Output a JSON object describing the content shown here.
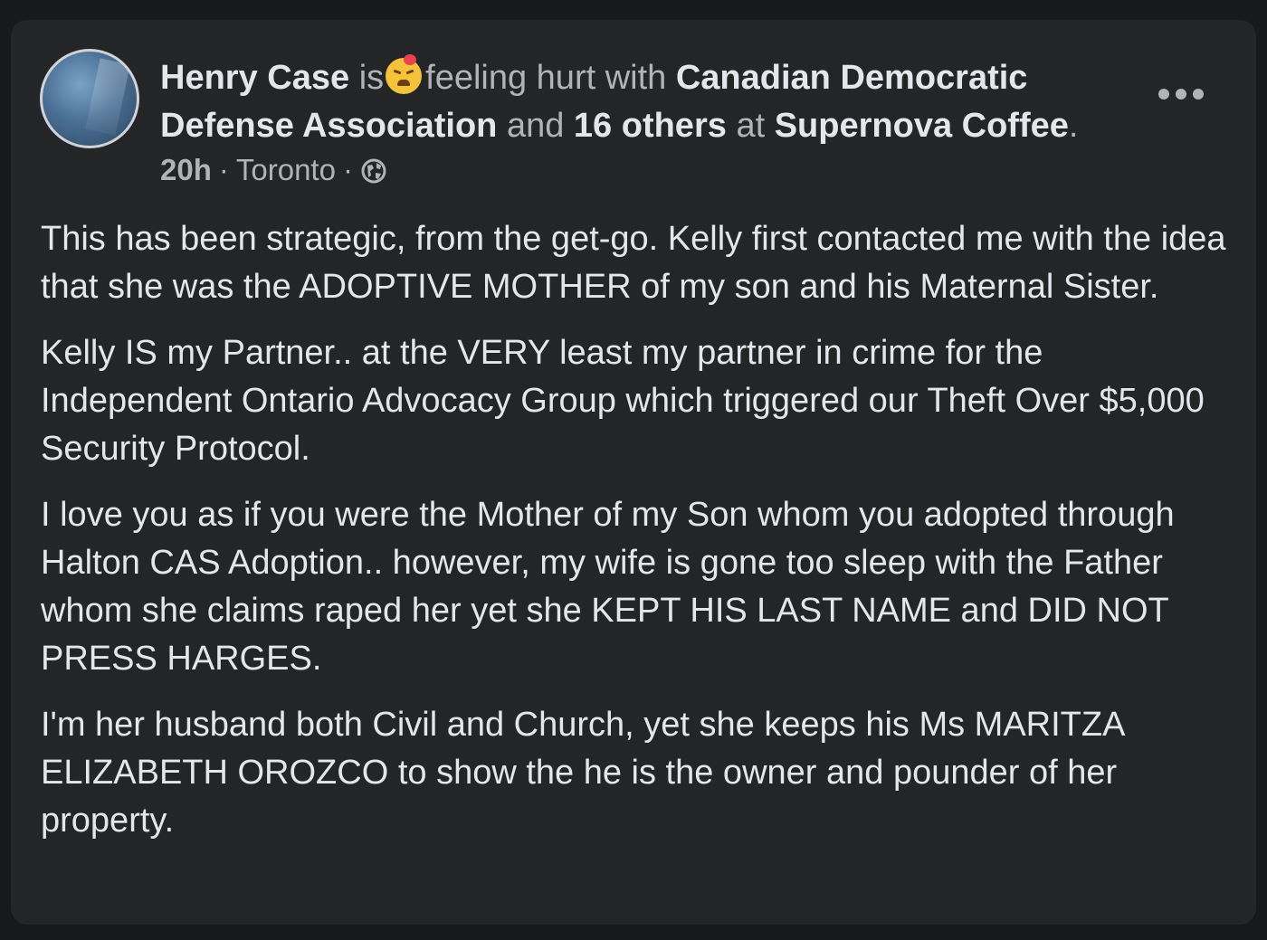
{
  "post": {
    "author": "Henry Case",
    "is_word": "is",
    "feeling_icon": "hurt-face-emoji",
    "feeling_text": "feeling hurt with",
    "with_group": "Canadian Democratic Defense Association",
    "and_word": "and",
    "others": "16 others",
    "at_word": "at",
    "place": "Supernova Coffee",
    "period": ".",
    "time": "20h",
    "dot1": "·",
    "location": "Toronto",
    "dot2": "·",
    "privacy_icon": "globe-icon",
    "more_icon": "more-options-icon",
    "paragraphs": [
      "This has been strategic, from the get-go. Kelly first contacted me with the idea that she was the ADOPTIVE MOTHER of my son and his Maternal Sister.",
      "Kelly IS my Partner.. at the VERY least my partner in crime for the Independent Ontario Advocacy Group which triggered our Theft Over $5,000 Security Protocol.",
      "I love you as if you were the Mother of my Son whom you adopted through Halton CAS Adoption.. however, my wife is gone too sleep with the Father whom she claims raped her yet she KEPT HIS LAST NAME and DID NOT PRESS HARGES.",
      "I'm her husband both Civil and Church, yet she keeps his Ms MARITZA ELIZABETH OROZCO to show the he is the owner and pounder of her property."
    ]
  },
  "colors": {
    "page_bg": "#18191a",
    "card_bg": "#242526",
    "primary_text": "#e4e6eb",
    "secondary_text": "#b0b3b8"
  }
}
